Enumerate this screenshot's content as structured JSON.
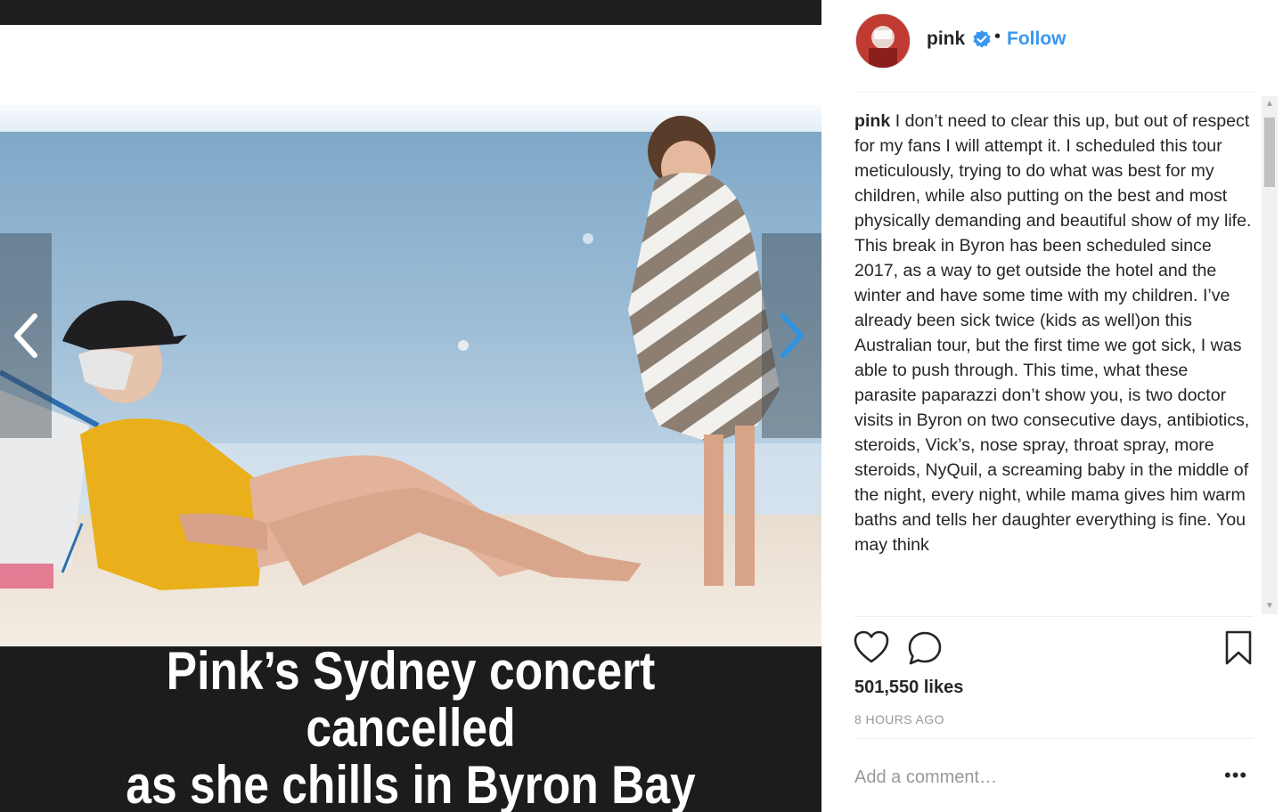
{
  "media": {
    "headline": "Pink’s Sydney concert cancelled\nas she chills in Byron Bay",
    "prev_icon": "chevron-left-icon",
    "next_icon": "chevron-right-icon"
  },
  "post": {
    "username": "pink",
    "verified_icon": "verified-badge-icon",
    "separator": "•",
    "follow_label": "Follow",
    "caption_user": "pink",
    "caption_text": " I don’t need to clear this up, but out of respect for my fans I will attempt it. I scheduled this tour meticulously, trying to do what was best for my children, while also putting on the best and most physically demanding and beautiful show of my life. This break in Byron has been scheduled since 2017, as a way to get outside the hotel and the winter and have some time with my children. I’ve already been sick twice (kids as well)on this Australian tour, but the first time we got sick, I was able to push through. This time, what these parasite paparazzi don’t show you, is two doctor visits in Byron on two consecutive days, antibiotics, steroids, Vick’s, nose spray, throat spray, more steroids, NyQuil, a screaming baby in the middle of the night, every night, while mama gives him warm baths and tells her daughter everything is fine. You may think",
    "likes": "501,550 likes",
    "time_ago": "8 HOURS AGO",
    "comment_placeholder": "Add a comment…",
    "more_label": "•••"
  },
  "colors": {
    "follow_blue": "#3897f0",
    "text": "#262626",
    "muted": "#999999",
    "headline_bg": "#1c1c1c"
  }
}
